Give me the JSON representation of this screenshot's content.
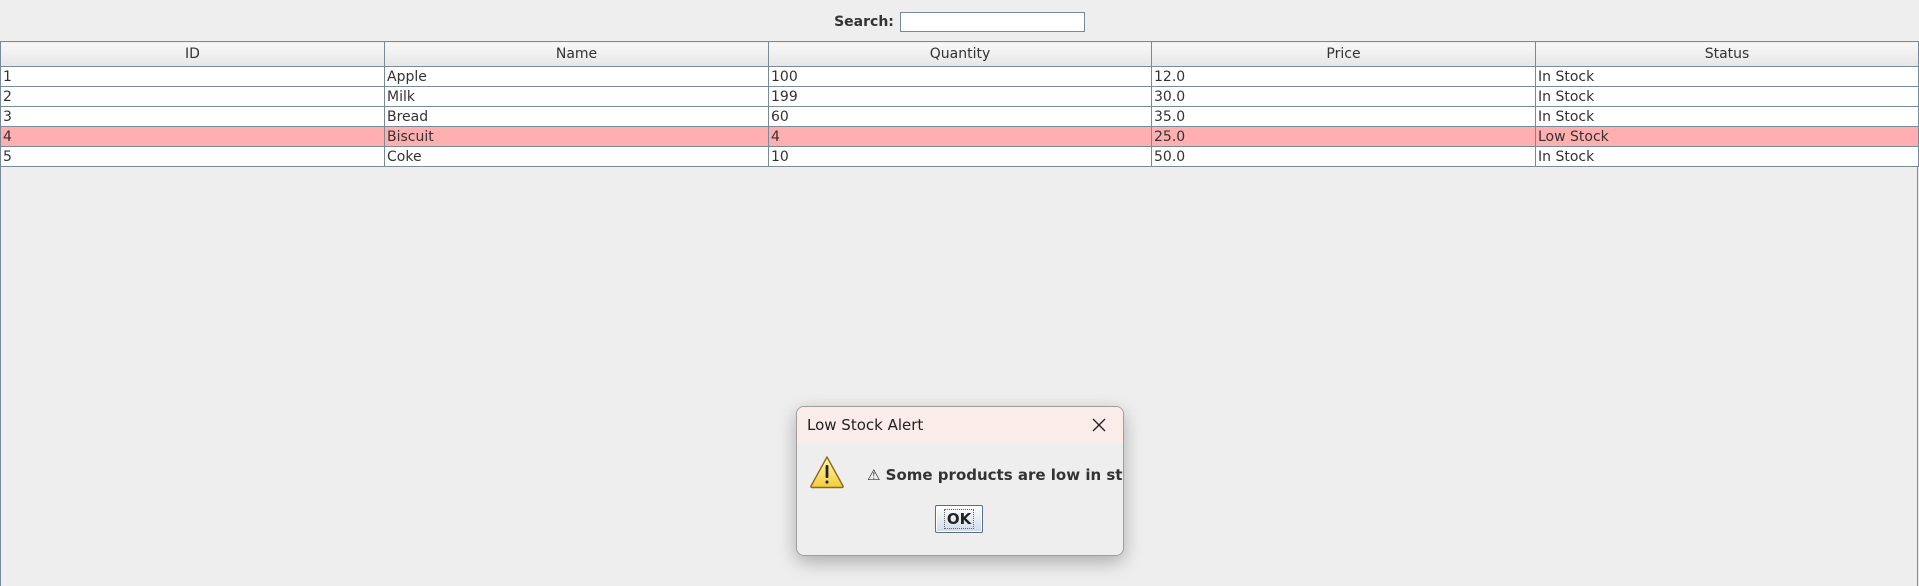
{
  "search": {
    "label": "Search:",
    "value": "",
    "placeholder": ""
  },
  "table": {
    "columns": [
      "ID",
      "Name",
      "Quantity",
      "Price",
      "Status"
    ],
    "rows": [
      {
        "id": "1",
        "name": "Apple",
        "quantity": "100",
        "price": "12.0",
        "status": "In Stock",
        "low": false
      },
      {
        "id": "2",
        "name": "Milk",
        "quantity": "199",
        "price": "30.0",
        "status": "In Stock",
        "low": false
      },
      {
        "id": "3",
        "name": "Bread",
        "quantity": "60",
        "price": "35.0",
        "status": "In Stock",
        "low": false
      },
      {
        "id": "4",
        "name": "Biscuit",
        "quantity": "4",
        "price": "25.0",
        "status": "Low Stock",
        "low": true
      },
      {
        "id": "5",
        "name": "Coke",
        "quantity": "10",
        "price": "50.0",
        "status": "In Stock",
        "low": false
      }
    ],
    "low_stock_color": "#ffafaf"
  },
  "dialog": {
    "title": "Low Stock Alert",
    "message": "⚠ Some products are low in stock!",
    "ok_label": "OK",
    "icon": "warning-icon",
    "close_icon": "close-icon"
  }
}
